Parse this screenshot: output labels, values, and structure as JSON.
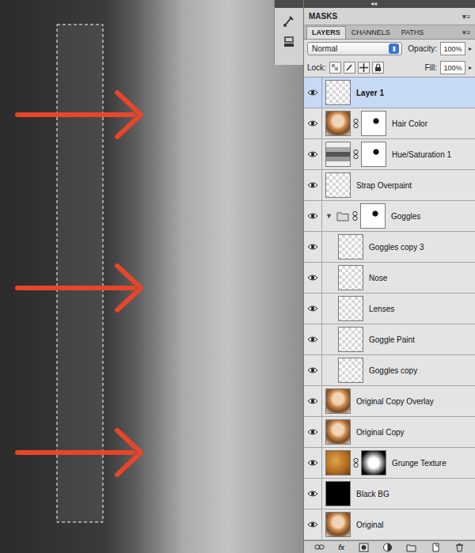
{
  "dock": {
    "collapse": "◂◂"
  },
  "masks_panel": {
    "title": "MASKS",
    "menu": "▾≡"
  },
  "tabs": [
    {
      "label": "LAYERS",
      "selected": true
    },
    {
      "label": "CHANNELS",
      "selected": false
    },
    {
      "label": "PATHS",
      "selected": false
    }
  ],
  "tabs_menu": "▾≡",
  "blend_mode": {
    "value": "Normal",
    "arrow": "⬍"
  },
  "opacity": {
    "label": "Opacity:",
    "value": "100%",
    "arrow": "▸"
  },
  "lock": {
    "label": "Lock:"
  },
  "fill": {
    "label": "Fill:",
    "value": "100%",
    "arrow": "▸"
  },
  "layers": [
    {
      "name": "Layer 1",
      "kind": "transparent",
      "visible": true,
      "selected": true,
      "mask": false,
      "in_group": false
    },
    {
      "name": "Hair Color",
      "kind": "photo",
      "visible": true,
      "selected": false,
      "mask": true,
      "in_group": false
    },
    {
      "name": "Hue/Saturation 1",
      "kind": "adjustment",
      "visible": true,
      "selected": false,
      "mask": true,
      "in_group": false
    },
    {
      "name": "Strap Overpaint",
      "kind": "transparent",
      "visible": true,
      "selected": false,
      "mask": false,
      "in_group": false
    },
    {
      "name": "Goggles",
      "kind": "group",
      "visible": true,
      "selected": false,
      "mask": true,
      "in_group": false,
      "expanded": true,
      "toggle": "▼"
    },
    {
      "name": "Goggles copy 3",
      "kind": "transparent",
      "visible": true,
      "selected": false,
      "mask": false,
      "in_group": true
    },
    {
      "name": "Nose",
      "kind": "transparent",
      "visible": true,
      "selected": false,
      "mask": false,
      "in_group": true
    },
    {
      "name": "Lenses",
      "kind": "transparent",
      "visible": true,
      "selected": false,
      "mask": false,
      "in_group": true
    },
    {
      "name": "Goggle Paint",
      "kind": "transparent",
      "visible": true,
      "selected": false,
      "mask": false,
      "in_group": true
    },
    {
      "name": "Goggles copy",
      "kind": "transparent",
      "visible": true,
      "selected": false,
      "mask": false,
      "in_group": true
    },
    {
      "name": "Original Copy Overlay",
      "kind": "photo",
      "visible": true,
      "selected": false,
      "mask": false,
      "in_group": false
    },
    {
      "name": "Original Copy",
      "kind": "photo",
      "visible": true,
      "selected": false,
      "mask": false,
      "in_group": false
    },
    {
      "name": "Grunge Texture",
      "kind": "texture",
      "visible": true,
      "selected": false,
      "mask": true,
      "in_group": false
    },
    {
      "name": "Black BG",
      "kind": "fill",
      "visible": true,
      "selected": false,
      "mask": false,
      "in_group": false
    },
    {
      "name": "Original",
      "kind": "photo",
      "visible": true,
      "selected": false,
      "mask": false,
      "in_group": false
    }
  ],
  "footer": {
    "fx_label": "fx"
  }
}
